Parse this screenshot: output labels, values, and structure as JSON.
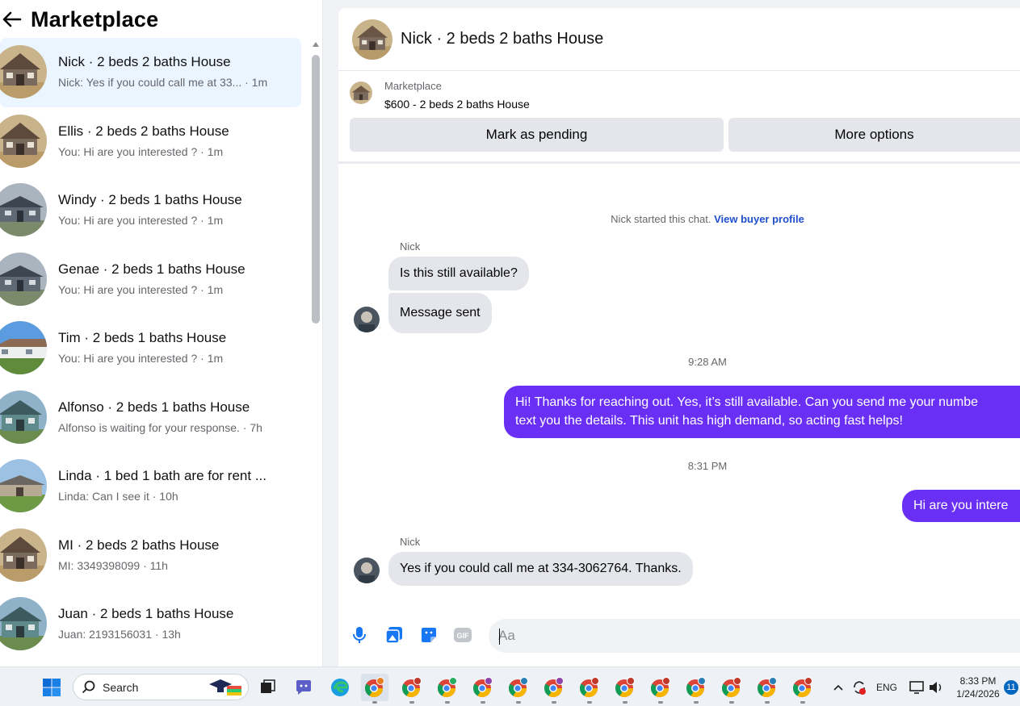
{
  "sidebar": {
    "title": "Marketplace",
    "conversations": [
      {
        "title": "Nick · 2 beds 2 baths House",
        "subtitle": "Nick: Yes if you could call me at 33... · 1m",
        "thumb": "brown-house"
      },
      {
        "title": "Ellis · 2 beds 2 baths House",
        "subtitle": "You: Hi are you interested ? · 1m",
        "thumb": "brown-house"
      },
      {
        "title": "Windy · 2 beds 1 baths House",
        "subtitle": "You: Hi are you interested ? · 1m",
        "thumb": "gray-house"
      },
      {
        "title": "Genae · 2 beds 1 baths House",
        "subtitle": "You: Hi are you interested ? · 1m",
        "thumb": "gray-house"
      },
      {
        "title": "Tim · 2 beds 1 baths House",
        "subtitle": "You: Hi are you interested ? · 1m",
        "thumb": "white-house"
      },
      {
        "title": "Alfonso · 2 beds 1 baths House",
        "subtitle": "Alfonso is waiting for your response. · 7h",
        "thumb": "teal-house"
      },
      {
        "title": "Linda · 1 bed 1 bath are for rent ...",
        "subtitle": "Linda: Can I see it · 10h",
        "thumb": "ranch-house"
      },
      {
        "title": "MI · 2 beds 2 baths House",
        "subtitle": "MI: 3349398099 · 11h",
        "thumb": "brown-house"
      },
      {
        "title": "Juan · 2 beds 1 baths House",
        "subtitle": "Juan: 2193156031 · 13h",
        "thumb": "teal-house"
      }
    ]
  },
  "chat": {
    "title": "Nick · 2 beds 2 baths House",
    "listing": {
      "source": "Marketplace",
      "price_title": "$600 - 2 beds 2 baths House",
      "mark_pending_label": "Mark as pending",
      "more_options_label": "More options"
    },
    "started_text": "Nick started this chat.",
    "view_profile_link": "View buyer profile",
    "messages": {
      "sender_1": "Nick",
      "in_1": "Is this still available?",
      "in_2": "Message sent",
      "time_1": "9:28 AM",
      "out_1_line1": "Hi! Thanks for reaching out. Yes, it’s still available. Can you send me your numbe",
      "out_1_line2": "text you the details. This unit has high demand, so acting fast helps!",
      "time_2": "8:31 PM",
      "out_2": "Hi are you intere",
      "sender_2": "Nick",
      "in_3": "Yes if you could call me at 334-3062764. Thanks."
    },
    "composer": {
      "placeholder": "Aa"
    }
  },
  "taskbar": {
    "search_label": "Search",
    "language": "ENG",
    "time": "8:33 PM",
    "date": "1/24/2026",
    "notification_count": "11"
  },
  "colors": {
    "outgoing_bubble": "#6a2ff5",
    "active_row": "#ebf5ff",
    "link": "#1f4fcc",
    "button_gray": "#e4e6eb"
  }
}
